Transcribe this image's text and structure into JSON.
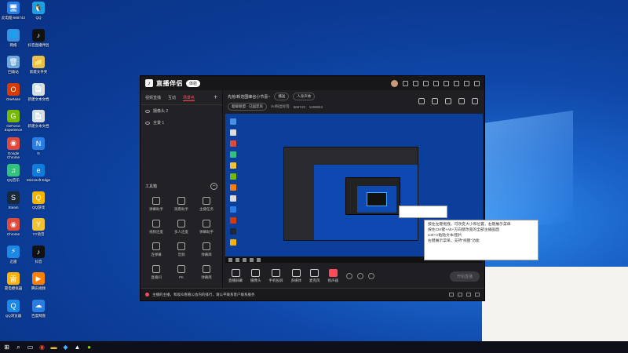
{
  "desktop": {
    "icons": [
      {
        "label": "此电脑\n666743",
        "color": "#2a7de1",
        "glyph": "🖥"
      },
      {
        "label": "QQ",
        "color": "#1ba1e2",
        "glyph": "🐧"
      },
      {
        "label": "网络",
        "color": "#3b8ee0",
        "glyph": "🌐"
      },
      {
        "label": "抖音直播伴侣",
        "color": "#111",
        "glyph": "♪"
      },
      {
        "label": "回收站",
        "color": "#6fa8dc",
        "glyph": "🗑"
      },
      {
        "label": "新建文件夹",
        "color": "#e8c14a",
        "glyph": "📁"
      },
      {
        "label": "OneNote",
        "color": "#d83b01",
        "glyph": "O"
      },
      {
        "label": "新建文本文档",
        "color": "#ddd",
        "glyph": "📄"
      },
      {
        "label": "GeForce Experience",
        "color": "#76b900",
        "glyph": "G"
      },
      {
        "label": "新建文本文档",
        "color": "#ddd",
        "glyph": "📄"
      },
      {
        "label": "Google Chrome",
        "color": "#e04a3a",
        "glyph": "◉"
      },
      {
        "label": "N",
        "color": "#2a7de1",
        "glyph": "N"
      },
      {
        "label": "QQ音乐",
        "color": "#31c27c",
        "glyph": "♫"
      },
      {
        "label": "Microsoft Edge",
        "color": "#0f7bdc",
        "glyph": "e"
      },
      {
        "label": "Steam",
        "color": "#1b2838",
        "glyph": "S"
      },
      {
        "label": "QQ游戏",
        "color": "#f5b400",
        "glyph": "Q"
      },
      {
        "label": "Chrome",
        "color": "#e04a3a",
        "glyph": "◉"
      },
      {
        "label": "YY语音",
        "color": "#f1c232",
        "glyph": "Y"
      },
      {
        "label": "迅雷",
        "color": "#1e88e5",
        "glyph": "⚡"
      },
      {
        "label": "抖音",
        "color": "#111",
        "glyph": "♪"
      },
      {
        "label": "雷电模拟器",
        "color": "#ffb300",
        "glyph": "雷"
      },
      {
        "label": "腾讯视频",
        "color": "#ff7f00",
        "glyph": "▶"
      },
      {
        "label": "QQ浏览器",
        "color": "#1e88e5",
        "glyph": "Q"
      },
      {
        "label": "百度网盘",
        "color": "#2a7de1",
        "glyph": "☁"
      }
    ]
  },
  "app": {
    "brand": "直播伴侣",
    "version_badge": "体验",
    "left_tabs": [
      "视频直播",
      "互动",
      "场景名"
    ],
    "scenes": [
      "摄像头 2",
      "全景 1"
    ],
    "tools_title": "工具箱",
    "tools": [
      "弹幕助手",
      "观看助手",
      "主播任务",
      "视频连麦",
      "多人连麦",
      "弹幕助手",
      "连弹幕",
      "音频",
      "弹幕库",
      "直播间",
      "PK",
      "弹幕库"
    ],
    "notice": "主播的主播，和观众看看公会内的排行，请公平联系客户联系服务",
    "room_title": "先抢/新范围峰谷小节喜~",
    "room_pill1": "播送",
    "room_pill2": "人身声故",
    "room_tag": "超级联盟 · 已固定房",
    "room_id": "zio粉丝标签",
    "room_num1": "666743",
    "room_num2": "1159824",
    "bottom_tools": [
      "直播屏幕",
      "摄像头",
      "手机投屏",
      "多媒体",
      "麦克风",
      "扬声器"
    ],
    "start_label": "开始直播"
  },
  "tooltip": {
    "lines": [
      "按住左键拖拽，可改变大小和位置，右键展示菜单",
      "按住CtrI键+Alt+方向键改变的全部主播画面",
      "Ctrl+V粘贴文本/图片",
      "右键展示菜单，支持\"视图\"功能"
    ]
  }
}
